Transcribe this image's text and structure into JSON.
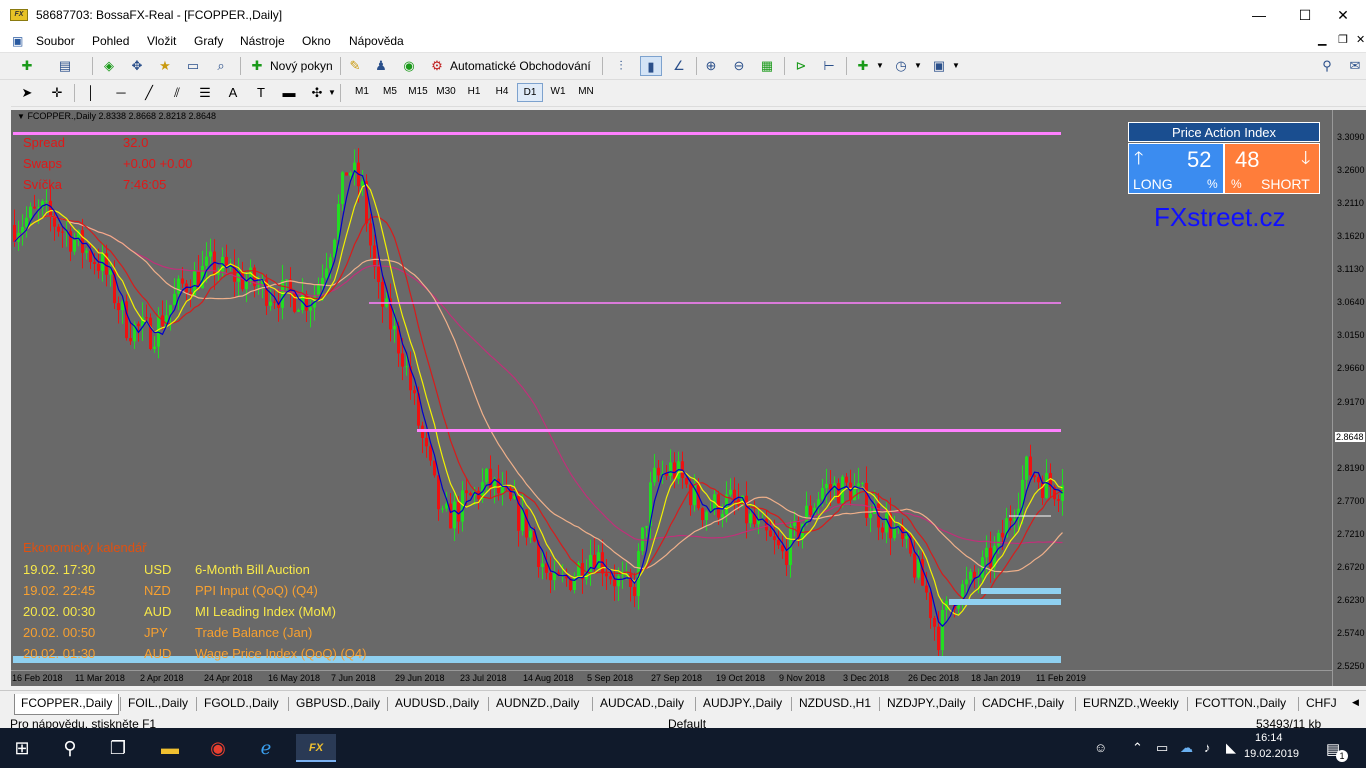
{
  "window": {
    "title": "58687703: BossaFX-Real - [FCOPPER.,Daily]",
    "app_icon": "mt4-icon",
    "minimize": "—",
    "maximize": "☐",
    "close": "✕"
  },
  "menu": [
    "Soubor",
    "Pohled",
    "Vložit",
    "Grafy",
    "Nástroje",
    "Okno",
    "Nápověda"
  ],
  "toolbar1": {
    "new_order_label": "Nový pokyn",
    "auto_trading_label": "Automatické Obchodování"
  },
  "toolbar2": {
    "timeframes": [
      "M1",
      "M5",
      "M15",
      "M30",
      "H1",
      "H4",
      "D1",
      "W1",
      "MN"
    ],
    "active_timeframe": "D1"
  },
  "chart": {
    "header": "FCOPPER.,Daily  2.8338 2.8668 2.8218 2.8648",
    "info_labels": [
      {
        "label": "Spread",
        "value": "32.0"
      },
      {
        "label": "Swaps",
        "value": "+0.00 +0.00"
      },
      {
        "label": "Svíčka",
        "value": "7:46:05"
      }
    ],
    "current_price": "2.8648",
    "price_labels": [
      "3.3090",
      "3.2600",
      "3.2110",
      "3.1620",
      "3.1130",
      "3.0640",
      "3.0150",
      "2.9660",
      "2.9170",
      "2.8648",
      "2.8190",
      "2.7700",
      "2.7210",
      "2.6720",
      "2.6230",
      "2.5740",
      "2.5250"
    ],
    "time_labels": [
      "16 Feb 2018",
      "11 Mar 2018",
      "2 Apr 2018",
      "24 Apr 2018",
      "16 May 2018",
      "7 Jun 2018",
      "29 Jun 2018",
      "23 Jul 2018",
      "14 Aug 2018",
      "5 Sep 2018",
      "27 Sep 2018",
      "19 Oct 2018",
      "9 Nov 2018",
      "3 Dec 2018",
      "26 Dec 2018",
      "18 Jan 2019",
      "11 Feb 2019"
    ],
    "calendar_title": "Ekonomický kalendář",
    "calendar": [
      {
        "time": "19.02. 17:30",
        "currency": "USD",
        "event": "6-Month Bill Auction"
      },
      {
        "time": "19.02. 22:45",
        "currency": "NZD",
        "event": "PPI Input (QoQ) (Q4)"
      },
      {
        "time": "20.02. 00:30",
        "currency": "AUD",
        "event": "MI Leading Index (MoM)"
      },
      {
        "time": "20.02. 00:50",
        "currency": "JPY",
        "event": "Trade Balance (Jan)"
      },
      {
        "time": "20.02. 01:30",
        "currency": "AUD",
        "event": "Wage Price Index (QoQ) (Q4)"
      }
    ]
  },
  "price_action_index": {
    "title": "Price Action Index",
    "long_value": "52",
    "long_label": "LONG",
    "short_value": "48",
    "short_label": "SHORT",
    "percent": "%"
  },
  "brand": "FXstreet.cz",
  "tabs": [
    "FCOPPER.,Daily",
    "FOIL.,Daily",
    "FGOLD.,Daily",
    "GBPUSD.,Daily",
    "AUDUSD.,Daily",
    "AUDNZD.,Daily",
    "AUDCAD.,Daily",
    "AUDJPY.,Daily",
    "NZDUSD.,H1",
    "NZDJPY.,Daily",
    "CADCHF.,Daily",
    "EURNZD.,Weekly",
    "FCOTTON.,Daily",
    "CHFJ"
  ],
  "status": {
    "help": "Pro nápovědu, stiskněte F1",
    "profile": "Default",
    "traffic": "53493/11 kb"
  },
  "taskbar": {
    "time": "16:14",
    "date": "19.02.2019",
    "notifications": "1"
  },
  "colors": {
    "chart_bg": "#696969",
    "bull_candle": "#22dd22",
    "bear_candle": "#ee1111",
    "ma_blue": "#0000cc",
    "ma_yellow": "#f2f200",
    "ma_red": "#d81b1b",
    "ma_peach": "#f0b08a",
    "ma_magenta": "#c0307a",
    "level_pink": "#ff80ff",
    "zone_blue": "#8fd0f0"
  }
}
